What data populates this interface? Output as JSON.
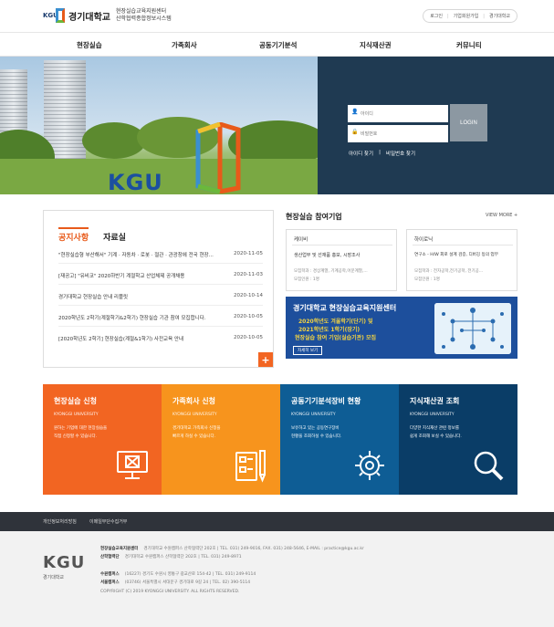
{
  "header": {
    "logo_short": "KGU",
    "logo_name": "경기대학교",
    "logo_sub_1": "현장실습교육지원센터",
    "logo_sub_2": "산학협력종합정보시스템",
    "util_links": [
      "로그인",
      "기업회원가입",
      "경기대학교"
    ]
  },
  "nav": {
    "items": [
      "현장실습",
      "가족회사",
      "공동기기분석",
      "지식재산권",
      "커뮤니티"
    ]
  },
  "hero": {
    "brand_text": "KGU",
    "login": {
      "id_placeholder": "아이디",
      "pw_placeholder": "비밀번호",
      "button_label": "LOGIN",
      "find_id": "아이디 찾기",
      "separator": "|",
      "find_pw": "비밀번호 찾기"
    }
  },
  "notice": {
    "tab_active": "공지사항",
    "tab_other": "자료실",
    "items": [
      {
        "title": "\"현장실습형 부산해서\" 기계 · 자동차 · 로봇 · 절관 · 관광창에 전국 현장...",
        "date": "2020-11-05"
      },
      {
        "title": "[재공고] \"유비코\" 2020하반기 계절학교 산업체제 공개채용",
        "date": "2020-11-03"
      },
      {
        "title": "경기대학교 현장실습 안내 리플릿",
        "date": "2020-10-14"
      },
      {
        "title": "2020학년도 2학기(계절학기&2학기) 현장실습 기관 참여 모집합니다.",
        "date": "2020-10-05"
      },
      {
        "title": "[2020학년도 2학기] 현장실습(계절&1학기) 사전교육 안내",
        "date": "2020-10-05"
      }
    ],
    "more_label": "+"
  },
  "companies": {
    "title": "현장실습 참여기업",
    "view_more": "VIEW MORE +",
    "cards": [
      {
        "name": "케이비",
        "desc": "생산업무 및 선재품 홍보, 시장조사",
        "meta1": "모집학과 : 경상계열, 기계공학,어문계열,...",
        "meta2": "모집인원 : 1명"
      },
      {
        "name": "하이로닉",
        "desc": "연구소 - H/W 회로 설계 검증, 디버깅 등의 업무",
        "meta1": "모집학과 : 전자공학,전기공학, 전기공...",
        "meta2": "모집인원 : 1명"
      }
    ],
    "banner": {
      "line1": "경기대학교 현장실습교육지원센터",
      "line2": "2020학년도 겨울학기(단기) 및",
      "line3": "2021학년도 1학기(장기)",
      "line4": "현장실습 참여 기업(실습기관) 모집",
      "button": "자세히 보기"
    }
  },
  "quick": [
    {
      "title": "현장실습 신청",
      "sub": "KYONGGI UNIVERSITY",
      "desc1": "원하는 기업에 대한 현장실습을",
      "desc2": "직접 신청할 수 있습니다.",
      "icon": "monitor-icon",
      "color": "#f26522"
    },
    {
      "title": "가족회사 신청",
      "sub": "KYONGGI UNIVERSITY",
      "desc1": "경기대학교 가족회사 신청을",
      "desc2": "빠르게 하실 수 있습니다.",
      "icon": "document-pen-icon",
      "color": "#f7941d"
    },
    {
      "title": "공동기기분석장비 현황",
      "sub": "KYONGGI UNIVERSITY",
      "desc1": "보유하고 있는 공동연구장비",
      "desc2": "현황을 조회하실 수 있습니다.",
      "icon": "gear-icon",
      "color": "#0e5d95"
    },
    {
      "title": "지식재산권 조회",
      "sub": "KYONGGI UNIVERSITY",
      "desc1": "다양한 지식재산 관련 정보를",
      "desc2": "쉽게 조회해 보실 수 있습니다.",
      "icon": "magnifier-icon",
      "color": "#0a3d67"
    }
  ],
  "footer": {
    "bar_links": [
      "개인정보처리방침",
      "이메일무단수집거부"
    ],
    "logo_short": "KGU",
    "logo_name": "경기대학교",
    "lines": [
      {
        "label": "현장실습교육지원센터",
        "text": "경기대학교 수원캠퍼스 산학협력단 202호 | TEL. 031) 249-9016, FAX. 031) 248-5646, E-MAIL : practice@kgu.ac.kr"
      },
      {
        "label": "산학협력단",
        "text": "경기대학교 수원캠퍼스 산학협력단 202호 | TEL. 031) 249-8971"
      },
      {
        "label": "수원캠퍼스",
        "text": "(16227) 경기도 수원시 영통구 광교산로 154-42 | TEL. 031) 249-9114"
      },
      {
        "label": "서울캠퍼스",
        "text": "(03746) 서울특별시 서대문구 경기대로 9길 24 | TEL. 02) 390-5114"
      },
      {
        "label": "",
        "text": "COPYRIGHT (C) 2019 KYONGGI UNIVERSITY. ALL RIGHTS RESERVED."
      }
    ]
  }
}
